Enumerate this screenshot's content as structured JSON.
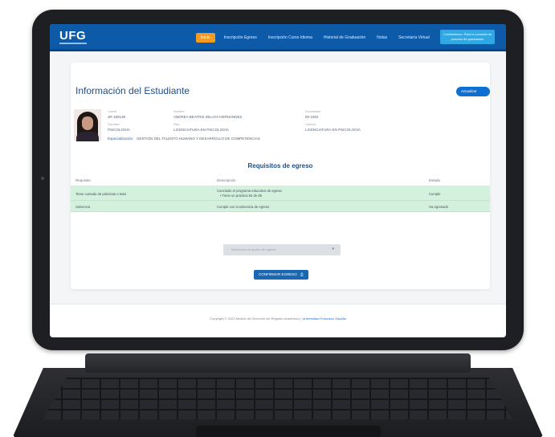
{
  "navbar": {
    "logo": "UFG",
    "items": [
      {
        "label": "Inicio",
        "active": true
      },
      {
        "label": "Inscripción Egreso",
        "active": false
      },
      {
        "label": "Inscripción Curso Idioma",
        "active": false
      },
      {
        "label": "Historial de Graduación",
        "active": false
      },
      {
        "label": "Notas",
        "active": false
      },
      {
        "label": "Secretaría Virtual",
        "active": false
      }
    ],
    "cta_label": "Contáctenos / Para la consulta de proceso de graduación"
  },
  "page": {
    "title": "Información del Estudiante",
    "update_button": "Actualizar datos"
  },
  "student": {
    "carnet_label": "Carnet",
    "carnet": "JR-180139",
    "nombre_label": "Nombre",
    "nombre": "ANDREA BEATRIZ ZELAYA HERNÁNDEZ",
    "doc_label": "Documento",
    "doc": "00-1502",
    "facultad_label": "Facultad",
    "facultad": "PSICOLOGÍA",
    "plan_label": "Plan",
    "plan": "LICENCIATURA EN PSICOLOGÍA",
    "carrera_label": "Carrera",
    "carrera": "LICENCIATURA EN PSICOLOGÍA",
    "especializacion_label": "Especialización:",
    "especializacion": "GESTIÓN DEL TALENTO HUMANO Y DESARROLLO DE COMPETENCIAS"
  },
  "requirements": {
    "title": "Requisitos de egreso",
    "headers": {
      "req": "Requisito",
      "desc": "Descripción",
      "estado": "Estado"
    },
    "rows": [
      {
        "req": "Tiene cursado de prácticas o tesis",
        "desc": "Concluido el programa educativo de egreso",
        "desc2": "• Tiene un práctica 83 de 85",
        "estado": "Cumple"
      },
      {
        "req": "Solvencia",
        "desc": "Cumple con la solvencia de egreso",
        "desc2": "",
        "estado": "Ha egresado"
      }
    ]
  },
  "form": {
    "select_placeholder": "Seleccione la opción de egreso",
    "confirm_label": "CONFIRMAR EGRESO"
  },
  "footer": {
    "text": "Copyright © 2023 Módulo de Dirección del Registro Académico |",
    "link": "Universidad Francisco Gavidia"
  }
}
